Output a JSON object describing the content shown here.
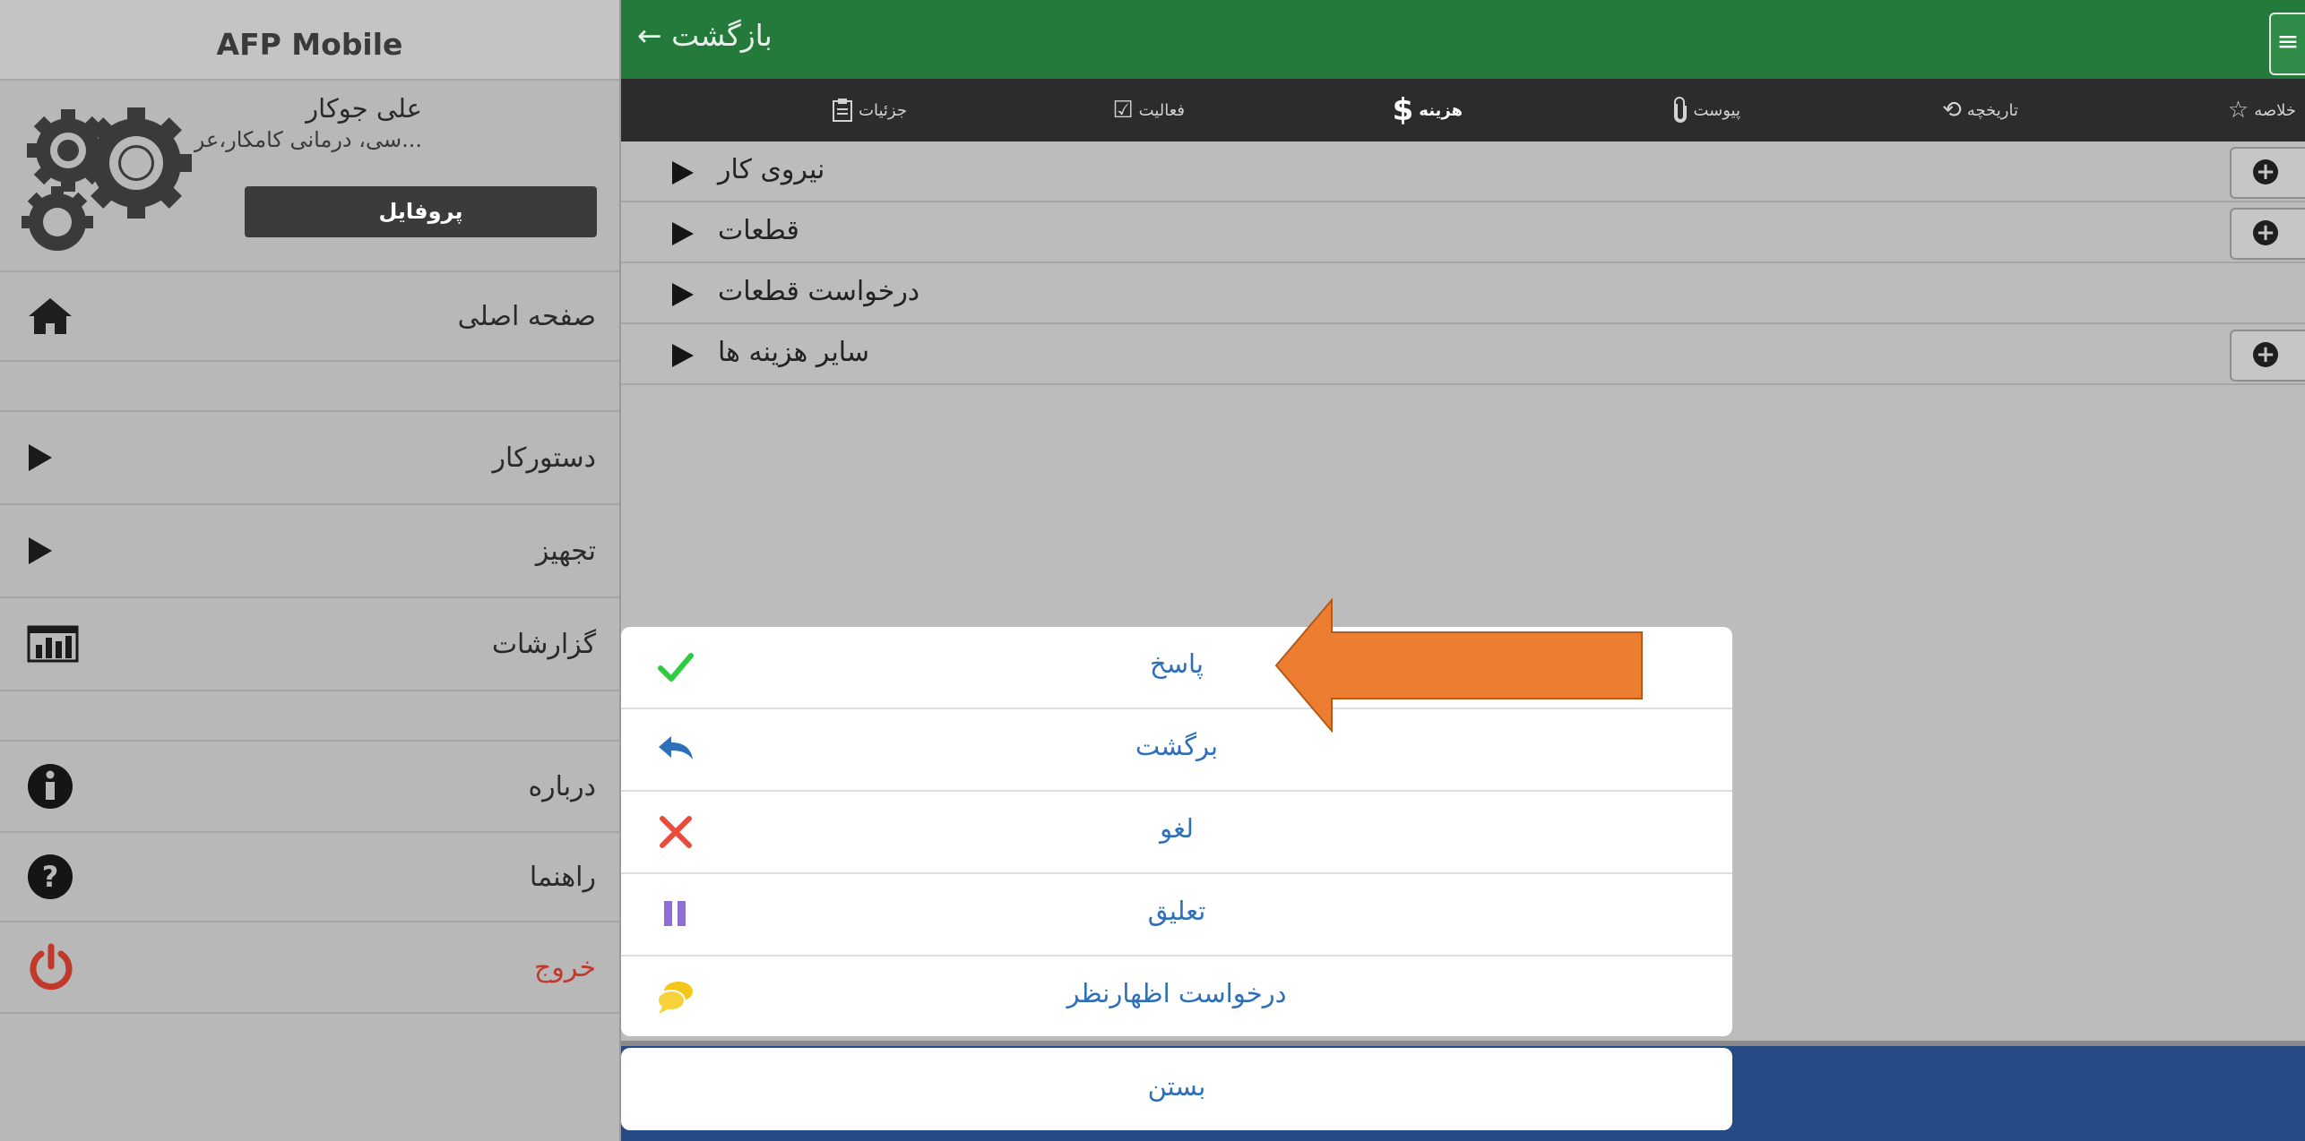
{
  "app": {
    "title": "AFP Mobile"
  },
  "profile": {
    "name": "علی جوکار",
    "subtitle": "...سی، درمانی کامکار،عرب ن",
    "button_label": "پروفایل"
  },
  "sidebar": {
    "items": [
      {
        "label": "صفحه اصلی",
        "icon": "home-icon"
      },
      {
        "label": "دستورکار",
        "icon": "play-arrow-icon"
      },
      {
        "label": "تجهیز",
        "icon": "play-arrow-icon"
      },
      {
        "label": "گزارشات",
        "icon": "chart-icon"
      },
      {
        "label": "درباره",
        "icon": "info-icon"
      },
      {
        "label": "راهنما",
        "icon": "help-icon"
      },
      {
        "label": "خروج",
        "icon": "power-icon",
        "color": "#c0392b"
      }
    ]
  },
  "topbar": {
    "back_label": "بازگشت ←",
    "menu_icon": "hamburger-icon"
  },
  "tabs": [
    {
      "label": "خلاصه",
      "icon": "star-icon"
    },
    {
      "label": "تاریخچه",
      "icon": "history-icon"
    },
    {
      "label": "پیوست",
      "icon": "paperclip-icon"
    },
    {
      "label": "هزینه",
      "icon": "dollar-icon",
      "active": true
    },
    {
      "label": "فعالیت",
      "icon": "checkbox-icon"
    },
    {
      "label": "جزئیات",
      "icon": "clipboard-icon"
    }
  ],
  "cost_rows": [
    {
      "label": "نیروی کار",
      "has_add": true
    },
    {
      "label": "قطعات",
      "has_add": true
    },
    {
      "label": "درخواست قطعات",
      "has_add": false
    },
    {
      "label": "سایر هزینه ها",
      "has_add": true
    }
  ],
  "actions": [
    {
      "label": "پاسخ",
      "icon": "check-icon",
      "color": "#2ecc40"
    },
    {
      "label": "برگشت",
      "icon": "reply-icon",
      "color": "#2d6fb8"
    },
    {
      "label": "لغو",
      "icon": "cross-icon",
      "color": "#e74c3c"
    },
    {
      "label": "تعلیق",
      "icon": "pause-icon",
      "color": "#8e6fd8"
    },
    {
      "label": "درخواست اظهارنظر",
      "icon": "chat-bubbles-icon",
      "color": "#f5c518"
    }
  ],
  "close_label": "بستن",
  "colors": {
    "topbar_green": "#237a3b",
    "link_blue": "#2d6fb8",
    "annotation_orange": "#ed7d31"
  }
}
